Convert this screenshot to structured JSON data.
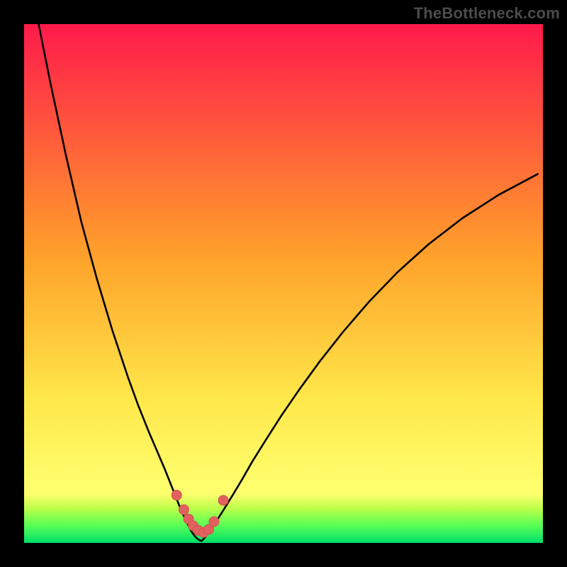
{
  "watermark": {
    "text": "TheBottleneck.com"
  },
  "colors": {
    "black": "#000000",
    "curve": "#000000",
    "markerFill": "#e0615e",
    "markerStroke": "#d2524f",
    "grad_top": "#ff1a4b",
    "grad_mid1": "#ff9a2a",
    "grad_mid2": "#ffe74a",
    "grad_band_yellow": "#ffff6e",
    "grad_band_lime": "#9cff4e",
    "grad_bottom": "#00e06a"
  },
  "chart_data": {
    "type": "line",
    "title": "",
    "xlabel": "",
    "ylabel": "",
    "xlim": [
      0,
      100
    ],
    "ylim": [
      0,
      100
    ],
    "series": [
      {
        "name": "left-branch",
        "x": [
          2.8,
          5,
          8,
          11,
          14,
          17,
          20,
          22,
          24,
          25.5,
          27,
          28,
          29,
          29.8,
          30.5,
          31.2,
          31.8,
          32.2,
          32.6,
          33,
          33.3,
          33.6,
          33.9,
          34.2
        ],
        "y": [
          100,
          89,
          75,
          62,
          51,
          41,
          32,
          26.5,
          21.5,
          18,
          14.5,
          12,
          9.5,
          7.5,
          5.8,
          4.3,
          3.1,
          2.3,
          1.7,
          1.2,
          0.9,
          0.65,
          0.48,
          0.36
        ]
      },
      {
        "name": "right-branch",
        "x": [
          34.2,
          35,
          36,
          37.2,
          38.6,
          40.2,
          42,
          44,
          46.5,
          49.5,
          53,
          57,
          61.5,
          66.5,
          72,
          78,
          84.5,
          91.5,
          99
        ],
        "y": [
          0.36,
          1.2,
          2.6,
          4.4,
          6.6,
          9.2,
          12.2,
          15.7,
          19.7,
          24.4,
          29.5,
          35,
          40.7,
          46.5,
          52.2,
          57.6,
          62.6,
          67.1,
          71.1
        ]
      }
    ],
    "markers": {
      "name": "trough-markers",
      "points": [
        {
          "x": 29.4,
          "y": 9.2
        },
        {
          "x": 30.8,
          "y": 6.4
        },
        {
          "x": 31.7,
          "y": 4.6
        },
        {
          "x": 32.6,
          "y": 3.3
        },
        {
          "x": 33.6,
          "y": 2.4
        },
        {
          "x": 34.6,
          "y": 2.0
        },
        {
          "x": 35.6,
          "y": 2.6
        },
        {
          "x": 36.6,
          "y": 4.1
        },
        {
          "x": 38.4,
          "y": 8.2
        }
      ],
      "radius_px": 7
    },
    "background_gradient": {
      "stops": [
        {
          "offset": 0.0,
          "color": "#ff1a4b"
        },
        {
          "offset": 0.45,
          "color": "#ffa22a"
        },
        {
          "offset": 0.72,
          "color": "#ffe74a"
        },
        {
          "offset": 0.895,
          "color": "#ffff6e"
        },
        {
          "offset": 0.905,
          "color": "#ffff6e"
        },
        {
          "offset": 0.935,
          "color": "#b9ff4a"
        },
        {
          "offset": 0.965,
          "color": "#5cff55"
        },
        {
          "offset": 1.0,
          "color": "#00e06a"
        }
      ]
    }
  }
}
